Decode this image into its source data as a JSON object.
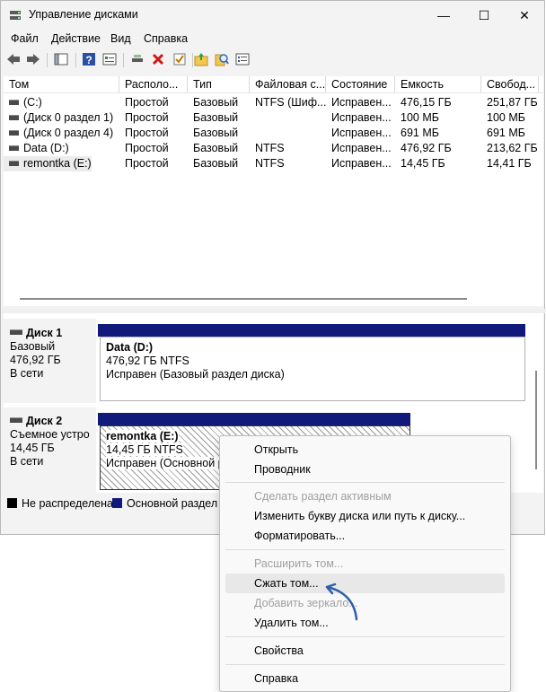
{
  "window": {
    "title": "Управление дисками",
    "controls": {
      "minimize": "—",
      "maximize": "☐",
      "close": "✕"
    }
  },
  "menu": [
    "Файл",
    "Действие",
    "Вид",
    "Справка"
  ],
  "toolbar": {
    "icons": [
      "back-icon",
      "forward-icon",
      "console-tree-icon",
      "help-icon",
      "properties-icon",
      "connect-icon",
      "delete-icon",
      "check-icon",
      "folder-up-icon",
      "search-icon",
      "list-icon"
    ]
  },
  "volumes": {
    "columns": [
      "Том",
      "Располо...",
      "Тип",
      "Файловая с...",
      "Состояние",
      "Емкость",
      "Свобод..."
    ],
    "rows": [
      [
        "(C:)",
        "Простой",
        "Базовый",
        "NTFS (Шиф...",
        "Исправен...",
        "476,15 ГБ",
        "251,87 ГБ"
      ],
      [
        "(Диск 0 раздел 1)",
        "Простой",
        "Базовый",
        "",
        "Исправен...",
        "100 МБ",
        "100 МБ"
      ],
      [
        "(Диск 0 раздел 4)",
        "Простой",
        "Базовый",
        "",
        "Исправен...",
        "691 МБ",
        "691 МБ"
      ],
      [
        "Data (D:)",
        "Простой",
        "Базовый",
        "NTFS",
        "Исправен...",
        "476,92 ГБ",
        "213,62 ГБ"
      ],
      [
        "remontka (E:)",
        "Простой",
        "Базовый",
        "NTFS",
        "Исправен...",
        "14,45 ГБ",
        "14,41 ГБ"
      ]
    ]
  },
  "disks": [
    {
      "name": "Диск 1",
      "type": "Базовый",
      "size": "476,92 ГБ",
      "status": "В сети",
      "partition": {
        "name": "Data  (D:)",
        "size_fs": "476,92 ГБ NTFS",
        "state": "Исправен (Базовый раздел диска)"
      }
    },
    {
      "name": "Диск 2",
      "type": "Съемное устро",
      "size": "14,45 ГБ",
      "status": "В сети",
      "partition": {
        "name": "remontka  (E:)",
        "size_fs": "14,45 ГБ NTFS",
        "state": "Исправен (Основной ра"
      }
    }
  ],
  "legend": [
    {
      "label": "Не распределена",
      "color": "#000000"
    },
    {
      "label": "Основной раздел",
      "color": "#0f1a7a"
    }
  ],
  "context_menu": {
    "items": [
      {
        "label": "Открыть",
        "disabled": false
      },
      {
        "label": "Проводник",
        "disabled": false
      },
      {
        "label": "Сделать раздел активным",
        "disabled": true
      },
      {
        "label": "Изменить букву диска или путь к диску...",
        "disabled": false
      },
      {
        "label": "Форматировать...",
        "disabled": false
      },
      {
        "label": "Расширить том...",
        "disabled": true
      },
      {
        "label": "Сжать том...",
        "disabled": false,
        "highlighted": true
      },
      {
        "label": "Добавить зеркало...",
        "disabled": true
      },
      {
        "label": "Удалить том...",
        "disabled": false
      },
      {
        "label": "Свойства",
        "disabled": false
      },
      {
        "label": "Справка",
        "disabled": false
      }
    ]
  },
  "colors": {
    "accent_bar": "#0f1a7a",
    "annotation_arrow": "#2f5fa8"
  }
}
